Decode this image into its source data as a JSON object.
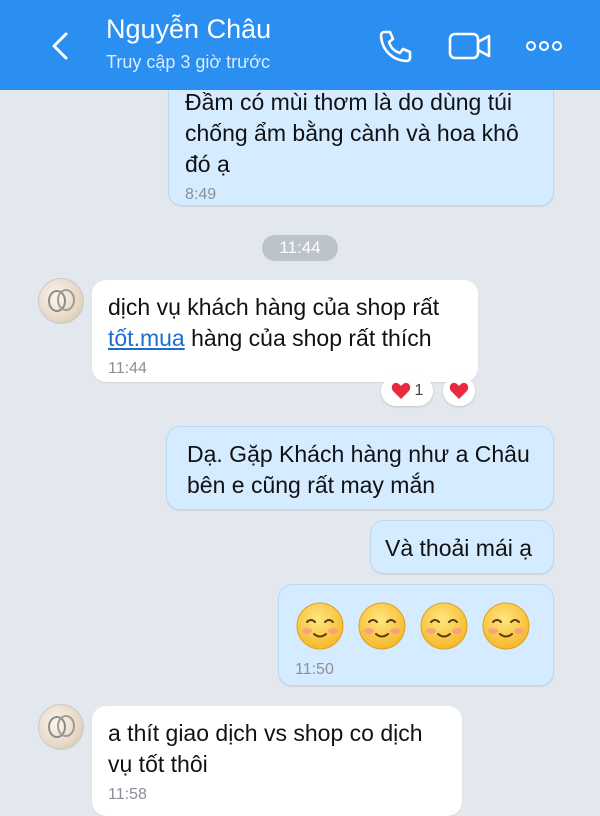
{
  "header": {
    "contact_name": "Nguyễn Châu",
    "status": "Truy cập 3 giờ trước",
    "icons": {
      "back": "back-arrow-icon",
      "call": "phone-icon",
      "video": "video-call-icon",
      "more": "more-options-icon"
    }
  },
  "colors": {
    "header_bg": "#2a8ff0",
    "chat_bg": "#e3e8ee",
    "my_bubble": "#d5ebff",
    "their_bubble": "#ffffff",
    "link": "#1d6fcf",
    "heart": "#e8293e"
  },
  "messages": [
    {
      "sender": "me",
      "text": "Đầm có mùi thơm là do dùng túi\nchống ẩm bằng cành và hoa khô\nđó ạ",
      "time": "8:49"
    },
    {
      "sender": "contact",
      "text_before": "dịch vụ khách hàng của shop rất\n",
      "link_text": "tốt.mua",
      "text_after": " hàng của shop rất thích",
      "time": "11:44",
      "reactions": {
        "count": "1"
      }
    },
    {
      "sender": "me",
      "text": "Dạ. Gặp Khách hàng như a Châu\nbên e cũng rất may mắn"
    },
    {
      "sender": "me",
      "text": "Và thoải mái ạ"
    },
    {
      "sender": "me",
      "type": "emoji",
      "emoji_count": 4,
      "emoji_name": "smiling-face-emoji",
      "time": "11:50"
    },
    {
      "sender": "contact",
      "text": "a thít giao dịch vs shop co dịch\nvụ tốt thôi",
      "time": "11:58"
    }
  ],
  "time_separator": "11:44"
}
